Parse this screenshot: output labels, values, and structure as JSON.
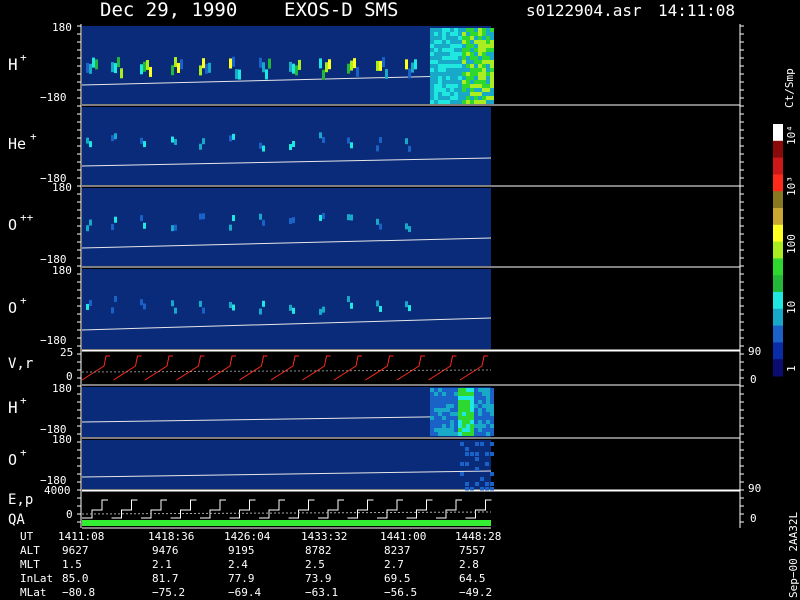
{
  "header": {
    "date": "Dec 29, 1990",
    "mission": "EXOS-D SMS",
    "file": "s0122904.asr",
    "time": "14:11:08"
  },
  "colors": {
    "background": "#000000",
    "panel_fill": "#0a2a7a",
    "trace": "#e6e6e6",
    "velocity_trace": "#ff2a1a",
    "qa_bar": "#33ee33",
    "text": "#ffffff"
  },
  "colorbar": {
    "title": "Ct/Smp",
    "tick_labels": [
      "1",
      "10",
      "100",
      "10³",
      "10⁴"
    ],
    "colors": [
      "#0c0c70",
      "#0a2ca8",
      "#1a62c8",
      "#18a8c8",
      "#1ee8e0",
      "#22b838",
      "#2ed82e",
      "#aaee22",
      "#ffff22",
      "#c8a830",
      "#8a7820",
      "#ff2a1a",
      "#cc1818",
      "#8a0a0a",
      "#ffffff"
    ]
  },
  "left_labels": {
    "h_plus": "H",
    "he_plus": "He",
    "o_plus_plus": "O",
    "o_plus": "O",
    "plus": "+",
    "plus_plus": "++",
    "vr": "V,r",
    "ep": "E,p",
    "qa": "QA"
  },
  "axis_ticks": {
    "top": "180",
    "bottom": "−180",
    "v25": "25",
    "v0": "0",
    "e4000": "4000",
    "e0": "0",
    "r90": "90",
    "r0": "0"
  },
  "chart_data": {
    "type": "heatmap",
    "title": "Dec 29, 1990   EXOS-D SMS",
    "panels": [
      "H+",
      "He+",
      "O++",
      "O+",
      "V,r",
      "H+",
      "O+",
      "E,p / QA"
    ],
    "angle_range": [
      -180,
      180
    ],
    "velocity_range": [
      0,
      25
    ],
    "energy_range": [
      0,
      4000
    ],
    "right_axis_range": [
      0,
      90
    ],
    "colorbar_range_counts_per_sample": [
      1,
      10000
    ],
    "colorbar_scale": "log"
  },
  "orbit_table": {
    "row_labels": [
      "UT",
      "ALT",
      "MLT",
      "InLat",
      "MLat"
    ],
    "columns": [
      [
        "1411:08",
        "9627",
        "1.5",
        "85.0",
        "−80.8"
      ],
      [
        "1418:36",
        "9476",
        "2.1",
        "81.7",
        "−75.2"
      ],
      [
        "1426:04",
        "9195",
        "2.4",
        "77.9",
        "−69.4"
      ],
      [
        "1433:32",
        "8782",
        "2.5",
        "73.9",
        "−63.1"
      ],
      [
        "1441:00",
        "8237",
        "2.7",
        "69.5",
        "−56.5"
      ],
      [
        "1448:28",
        "7557",
        "2.8",
        "64.5",
        "−49.2"
      ]
    ]
  },
  "footer": {
    "version": "Sep−00 2AA32L"
  }
}
